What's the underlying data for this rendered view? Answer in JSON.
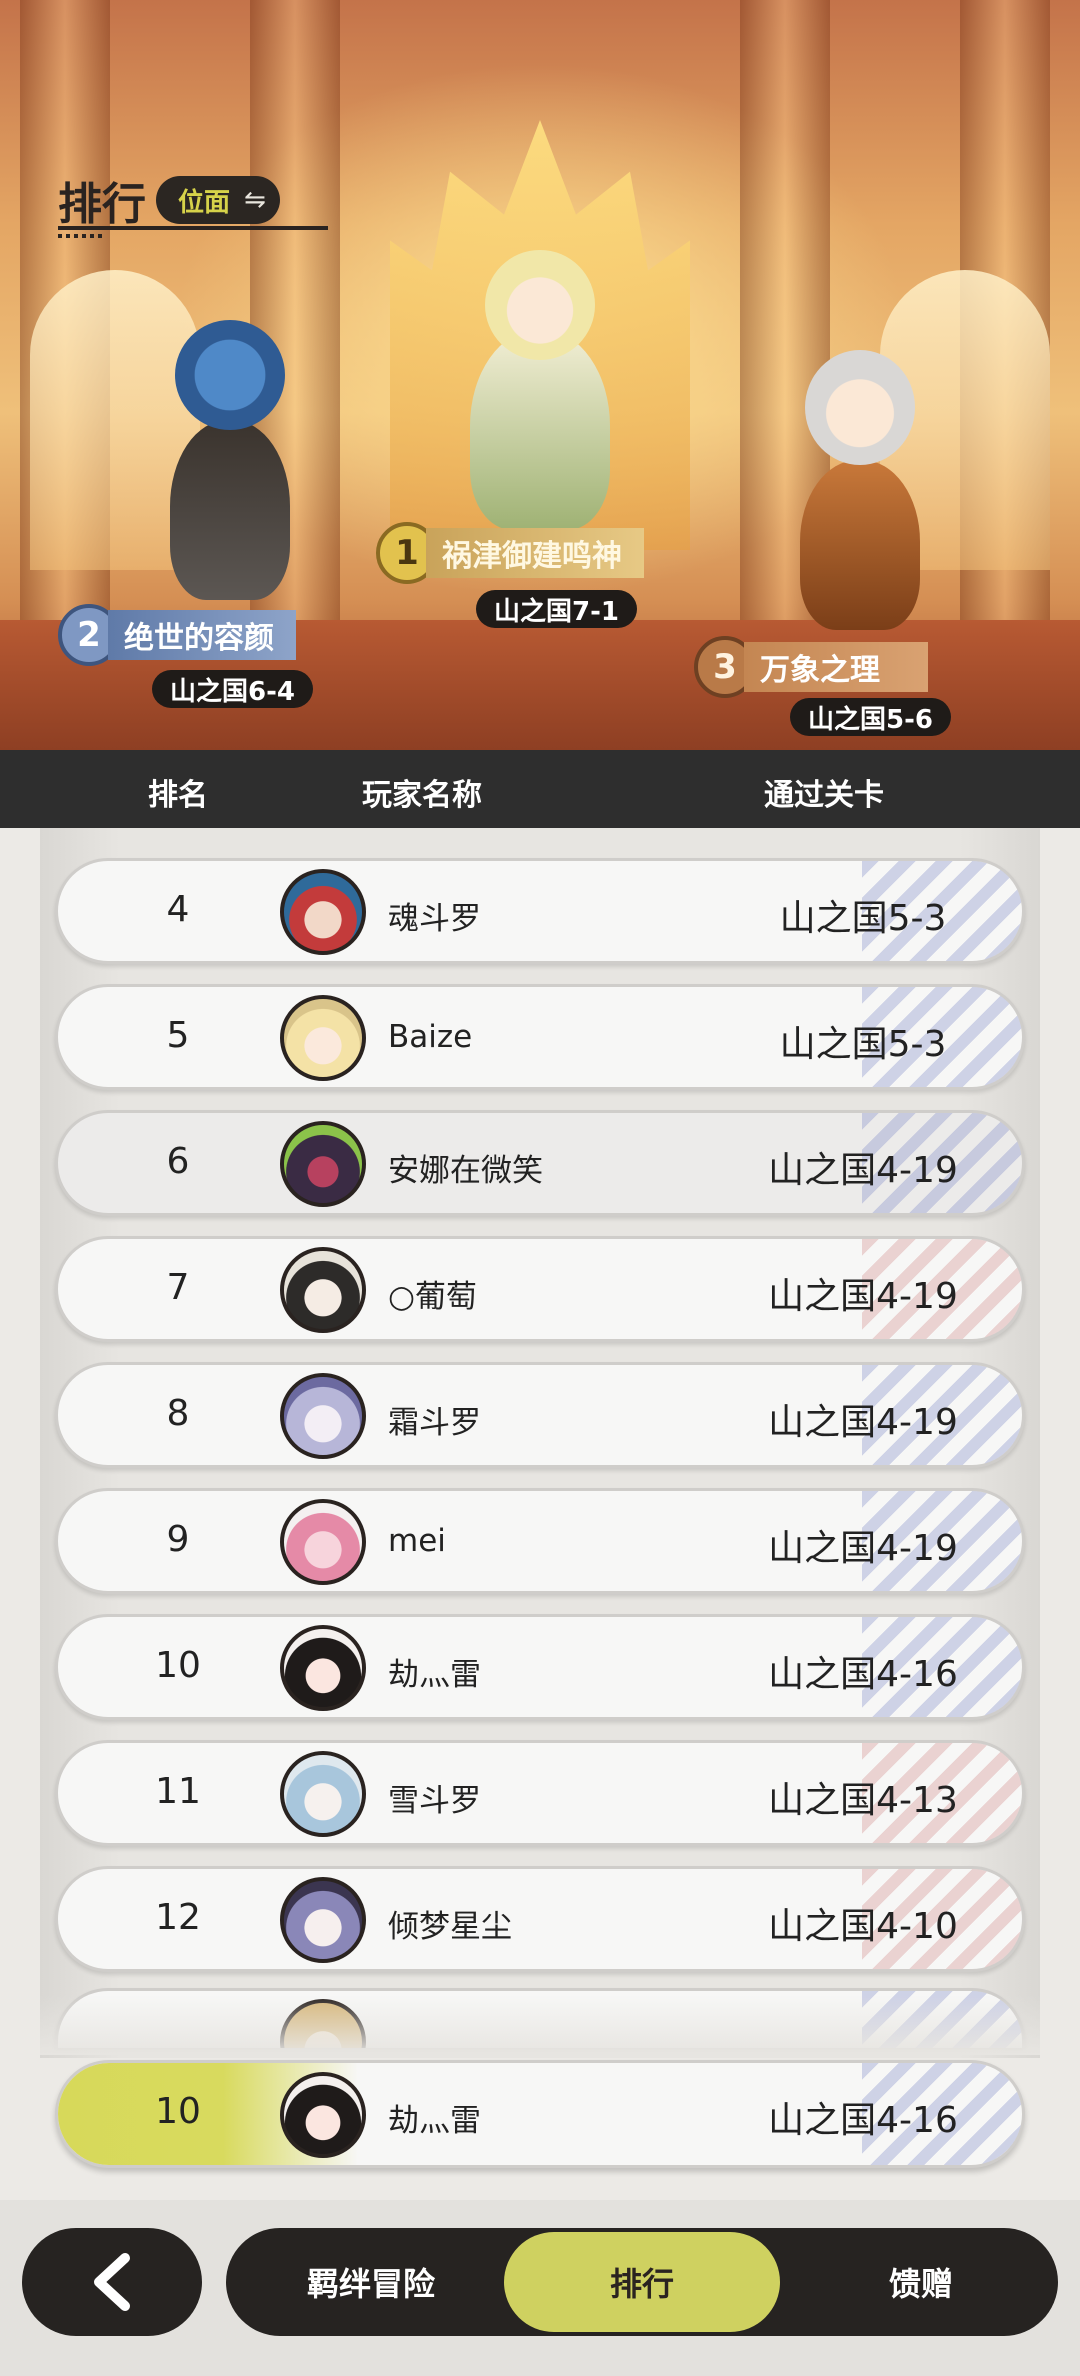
{
  "header": {
    "title": "排行",
    "mode_label": "位面",
    "swap_icon": "⇋"
  },
  "podium": [
    {
      "rank": "1",
      "name": "祸津御建鸣神",
      "stage": "山之国7-1"
    },
    {
      "rank": "2",
      "name": "绝世的容颜",
      "stage": "山之国6-4"
    },
    {
      "rank": "3",
      "name": "万象之理",
      "stage": "山之国5-6"
    }
  ],
  "columns": {
    "rank": "排名",
    "player": "玩家名称",
    "stage": "通过关卡"
  },
  "rows": [
    {
      "rank": "4",
      "name": "魂斗罗",
      "stage": "山之国5-3"
    },
    {
      "rank": "5",
      "name": "Baize",
      "stage": "山之国5-3"
    },
    {
      "rank": "6",
      "name": "安娜在微笑",
      "stage": "山之国4-19"
    },
    {
      "rank": "7",
      "name": "○葡萄",
      "stage": "山之国4-19"
    },
    {
      "rank": "8",
      "name": "霜斗罗",
      "stage": "山之国4-19"
    },
    {
      "rank": "9",
      "name": "mei",
      "stage": "山之国4-19"
    },
    {
      "rank": "10",
      "name": "劫灬雷",
      "stage": "山之国4-16"
    },
    {
      "rank": "11",
      "name": "雪斗罗",
      "stage": "山之国4-13"
    },
    {
      "rank": "12",
      "name": "倾梦星尘",
      "stage": "山之国4-10"
    }
  ],
  "my_row": {
    "rank": "10",
    "name": "劫灬雷",
    "stage": "山之国4-16"
  },
  "nav": {
    "back_icon": "chevron-left-icon",
    "tabs": [
      {
        "label": "羁绊冒险",
        "active": false
      },
      {
        "label": "排行",
        "active": true
      },
      {
        "label": "馈赠",
        "active": false
      }
    ]
  },
  "colors": {
    "accent": "#cfd160",
    "dark": "#262321",
    "header_bg": "#2e2e2e"
  }
}
